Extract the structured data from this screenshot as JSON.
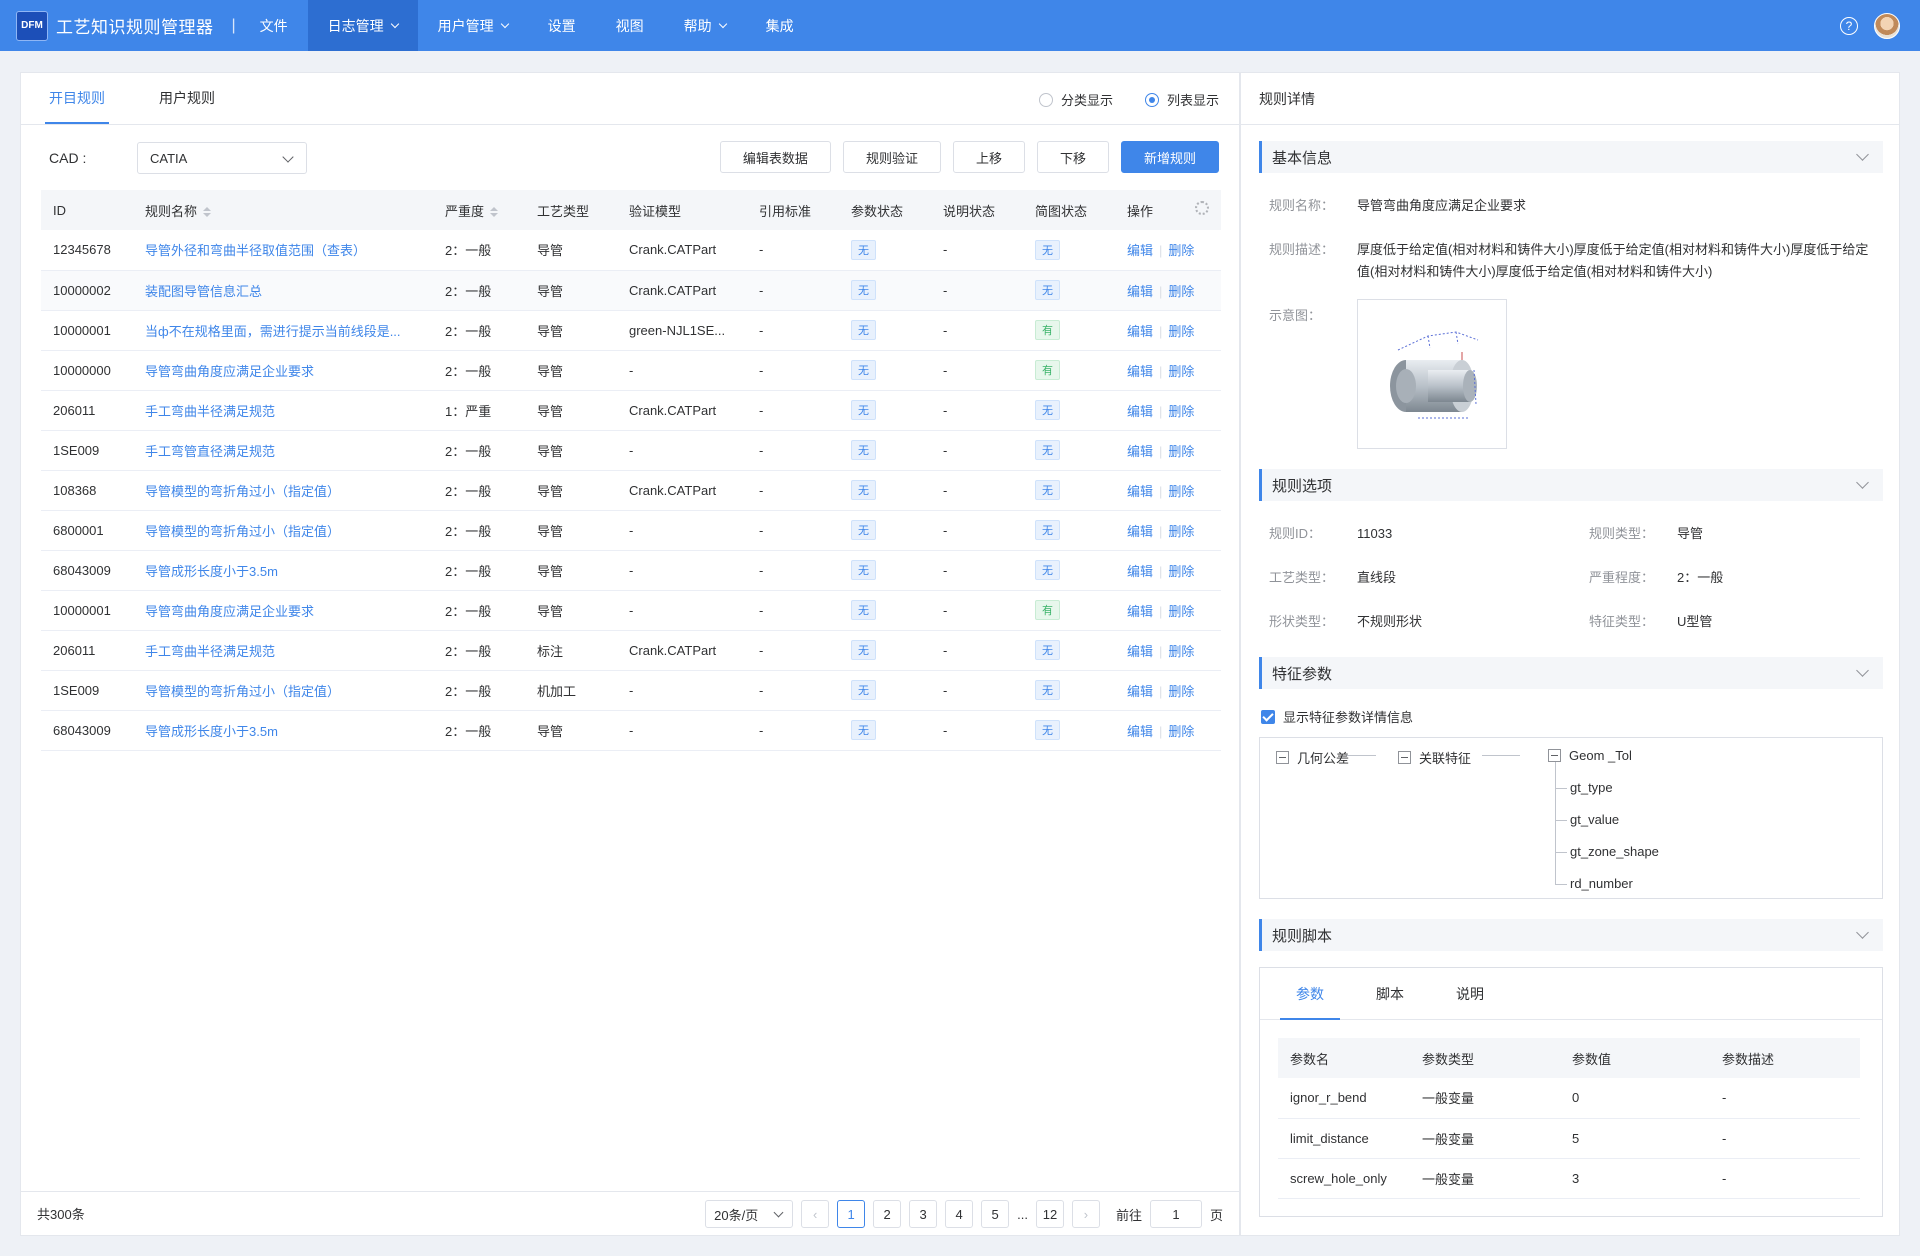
{
  "app": {
    "logo": "DFM",
    "title": "工艺知识规则管理器",
    "separator": "|",
    "menu": [
      {
        "label": "文件",
        "has_dropdown": false,
        "active": false
      },
      {
        "label": "日志管理",
        "has_dropdown": true,
        "active": true
      },
      {
        "label": "用户管理",
        "has_dropdown": true,
        "active": false
      },
      {
        "label": "设置",
        "has_dropdown": false,
        "active": false
      },
      {
        "label": "视图",
        "has_dropdown": false,
        "active": false
      },
      {
        "label": "帮助",
        "has_dropdown": true,
        "active": false
      },
      {
        "label": "集成",
        "has_dropdown": false,
        "active": false
      }
    ],
    "help_glyph": "?"
  },
  "left": {
    "tabs": [
      "开目规则",
      "用户规则"
    ],
    "active_tab": 0,
    "view_options": [
      {
        "label": "分类显示",
        "selected": false
      },
      {
        "label": "列表显示",
        "selected": true
      }
    ],
    "cad_label": "CAD :",
    "cad_value": "CATIA",
    "buttons": [
      "编辑表数据",
      "规则验证",
      "上移",
      "下移",
      "新增规则"
    ],
    "table": {
      "columns": [
        "ID",
        "规则名称",
        "严重度",
        "工艺类型",
        "验证模型",
        "引用标准",
        "参数状态",
        "说明状态",
        "简图状态",
        "操作"
      ],
      "edit_label": "编辑",
      "delete_label": "删除",
      "rows": [
        {
          "id": "12345678",
          "name": "导管外径和弯曲半径取值范围（查表）",
          "severity": "2：一般",
          "process": "导管",
          "model": "Crank.CATPart",
          "standard": "-",
          "param": "无",
          "desc": "-",
          "sketch": "无"
        },
        {
          "id": "10000002",
          "name": "装配图导管信息汇总",
          "severity": "2：一般",
          "process": "导管",
          "model": "Crank.CATPart",
          "standard": "-",
          "param": "无",
          "desc": "-",
          "sketch": "无"
        },
        {
          "id": "10000001",
          "name": "当ф不在规格里面，需进行提示当前线段是...",
          "severity": "2：一般",
          "process": "导管",
          "model": "green-NJL1SE...",
          "standard": "-",
          "param": "无",
          "desc": "-",
          "sketch": "有"
        },
        {
          "id": "10000000",
          "name": "导管弯曲角度应满足企业要求",
          "severity": "2：一般",
          "process": "导管",
          "model": "-",
          "standard": "-",
          "param": "无",
          "desc": "-",
          "sketch": "有"
        },
        {
          "id": "206011",
          "name": "手工弯曲半径满足规范",
          "severity": "1：严重",
          "process": "导管",
          "model": "Crank.CATPart",
          "standard": "-",
          "param": "无",
          "desc": "-",
          "sketch": "无"
        },
        {
          "id": "1SE009",
          "name": "手工弯管直径满足规范",
          "severity": "2：一般",
          "process": "导管",
          "model": "-",
          "standard": "-",
          "param": "无",
          "desc": "-",
          "sketch": "无"
        },
        {
          "id": "108368",
          "name": "导管模型的弯折角过小（指定值）",
          "severity": "2：一般",
          "process": "导管",
          "model": "Crank.CATPart",
          "standard": "-",
          "param": "无",
          "desc": "-",
          "sketch": "无"
        },
        {
          "id": "6800001",
          "name": "导管模型的弯折角过小（指定值）",
          "severity": "2：一般",
          "process": "导管",
          "model": "-",
          "standard": "-",
          "param": "无",
          "desc": "-",
          "sketch": "无"
        },
        {
          "id": "68043009",
          "name": "导管成形长度小于3.5m",
          "severity": "2：一般",
          "process": "导管",
          "model": "-",
          "standard": "-",
          "param": "无",
          "desc": "-",
          "sketch": "无"
        },
        {
          "id": "10000001",
          "name": "导管弯曲角度应满足企业要求",
          "severity": "2：一般",
          "process": "导管",
          "model": "-",
          "standard": "-",
          "param": "无",
          "desc": "-",
          "sketch": "有"
        },
        {
          "id": "206011",
          "name": "手工弯曲半径满足规范",
          "severity": "2：一般",
          "process": "标注",
          "model": "Crank.CATPart",
          "standard": "-",
          "param": "无",
          "desc": "-",
          "sketch": "无"
        },
        {
          "id": "1SE009",
          "name": "导管模型的弯折角过小（指定值）",
          "severity": "2：一般",
          "process": "机加工",
          "model": "-",
          "standard": "-",
          "param": "无",
          "desc": "-",
          "sketch": "无"
        },
        {
          "id": "68043009",
          "name": "导管成形长度小于3.5m",
          "severity": "2：一般",
          "process": "导管",
          "model": "-",
          "standard": "-",
          "param": "无",
          "desc": "-",
          "sketch": "无"
        }
      ]
    },
    "footer": {
      "total": "共300条",
      "page_size": "20条/页",
      "pages": [
        "1",
        "2",
        "3",
        "4",
        "5",
        "...",
        "12"
      ],
      "current_page": "1",
      "goto_label": "前往",
      "goto_value": "1",
      "page_suffix": "页"
    }
  },
  "right": {
    "title": "规则详情",
    "basic": {
      "section": "基本信息",
      "name_label": "规则名称：",
      "name_value": "导管弯曲角度应满足企业要求",
      "desc_label": "规则描述：",
      "desc_value": "厚度低于给定值(相对材料和铸件大小)厚度低于给定值(相对材料和铸件大小)厚度低于给定值(相对材料和铸件大小)厚度低于给定值(相对材料和铸件大小)",
      "image_label": "示意图："
    },
    "options": {
      "section": "规则选项",
      "items": [
        {
          "label": "规则ID：",
          "value": "11033"
        },
        {
          "label": "规则类型：",
          "value": "导管"
        },
        {
          "label": "工艺类型：",
          "value": "直线段"
        },
        {
          "label": "严重程度：",
          "value": "2：一般"
        },
        {
          "label": "形状类型：",
          "value": "不规则形状"
        },
        {
          "label": "特征类型：",
          "value": "U型管"
        }
      ]
    },
    "features": {
      "section": "特征参数",
      "checkbox_label": "显示特征参数详情信息",
      "checked": true,
      "tree": {
        "node1": "几何公差",
        "node2": "关联特征",
        "node3": "Geom _Tol",
        "children": [
          "gt_type",
          "gt_value",
          "gt_zone_shape",
          "rd_number"
        ]
      }
    },
    "script": {
      "section": "规则脚本",
      "tabs": [
        "参数",
        "脚本",
        "说明"
      ],
      "active_tab": 0,
      "columns": [
        "参数名",
        "参数类型",
        "参数值",
        "参数描述"
      ],
      "rows": [
        {
          "name": "ignor_r_bend",
          "type": "一般变量",
          "value": "0",
          "desc": "-"
        },
        {
          "name": "limit_distance",
          "type": "一般变量",
          "value": "5",
          "desc": "-"
        },
        {
          "name": "screw_hole_only",
          "type": "一般变量",
          "value": "3",
          "desc": "-"
        }
      ]
    }
  }
}
